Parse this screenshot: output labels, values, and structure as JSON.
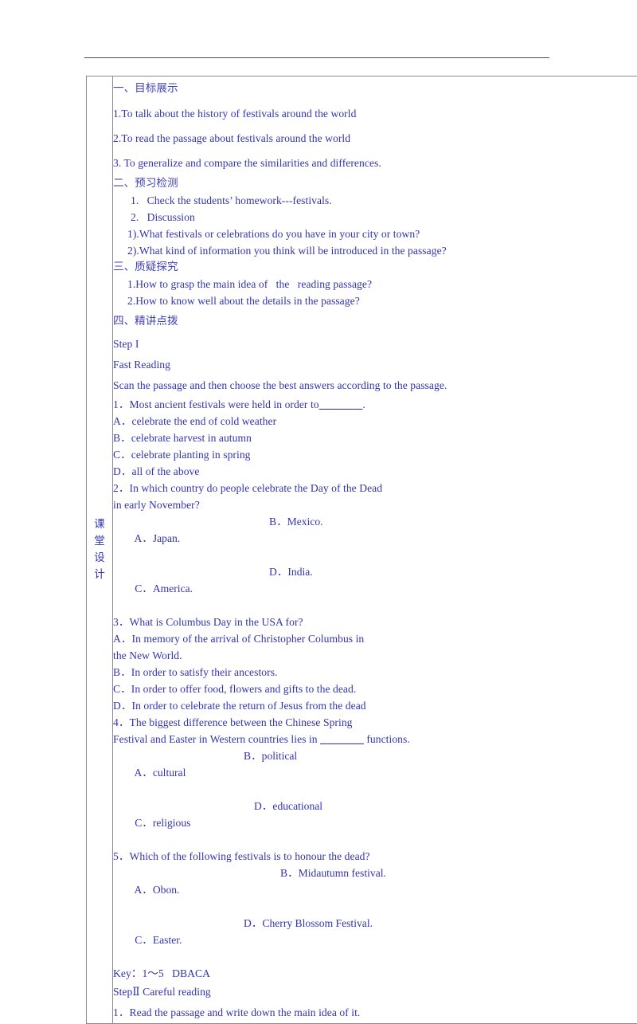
{
  "document": {
    "text_color": "#3333b0",
    "heading_color": "#4343b8",
    "rule_color": "#4a4a4a",
    "border_color": "#8a8a8a"
  },
  "row_label": {
    "chars": [
      "课",
      "堂",
      "设",
      "计"
    ],
    "full": "课堂设计"
  },
  "sections": {
    "s1": {
      "heading": "一、目标展示",
      "items": [
        "1.To talk about the history of festivals around the world",
        "2.To read the passage about festivals around the world",
        "3. To generalize and compare the similarities and differences."
      ]
    },
    "s2": {
      "heading": "二、预习检测",
      "items": [
        "1.   Check the students’ homework---festivals.",
        "2.   Discussion",
        "1).What festivals or celebrations do you have in your city or town?",
        "2).What kind of information you think will be introduced in the passage?"
      ]
    },
    "s3": {
      "heading": "三、质疑探究",
      "items": [
        "1.How to grasp the main idea of   the   reading passage?",
        "2.How to know well about the details in the passage?"
      ]
    },
    "s4": {
      "heading": "四、精讲点拨",
      "step1_label": "Step I",
      "fast_reading_label": "Fast Reading",
      "instruction": "Scan the passage and then choose the best answers according to the passage.",
      "questions": [
        {
          "stem": "1．Most ancient festivals were held in order to",
          "blank": "________",
          "stem_tail": ".",
          "options_single": [
            "A．celebrate the end of cold weather",
            "B．celebrate harvest in autumn",
            "C．celebrate planting in spring",
            "D．all of the above"
          ]
        },
        {
          "stem": "2．In which country do people celebrate the Day of the Dead",
          "stem_line2": "in early November?",
          "options_pairs": [
            {
              "left": "A．Japan.",
              "right": "B．Mexico."
            },
            {
              "left": "C．America.",
              "right": "D．India."
            }
          ]
        },
        {
          "stem": "3．What is Columbus Day in the USA for?",
          "options_single": [
            "A．In memory of the arrival of Christopher Columbus in",
            "the New World.",
            "B．In order to satisfy their ancestors.",
            "C．In order to offer food, flowers and gifts to the dead.",
            "D．In order to celebrate the return of Jesus from the dead"
          ]
        },
        {
          "stem": "4．The biggest difference between the Chinese Spring",
          "stem_line2_pre": "Festival and Easter in Western countries lies in ",
          "blank": "________",
          "stem_line2_post": " functions.",
          "options_pairs": [
            {
              "left": "A．cultural",
              "right": "B．political"
            },
            {
              "left": "C．religious",
              "right": "D．educational"
            }
          ]
        },
        {
          "stem": "5．Which of the following festivals is to honour the dead?",
          "options_pairs": [
            {
              "left": "A．Obon.",
              "right": "B．Midautumn festival."
            },
            {
              "left": "C．Easter.",
              "right": "D．Cherry Blossom Festival."
            }
          ]
        }
      ],
      "key_line": "Key：1～5   DBACA",
      "step2_label": "StepⅡ Careful reading",
      "step2_item1": "1．Read the passage and write down the main idea of it."
    }
  }
}
